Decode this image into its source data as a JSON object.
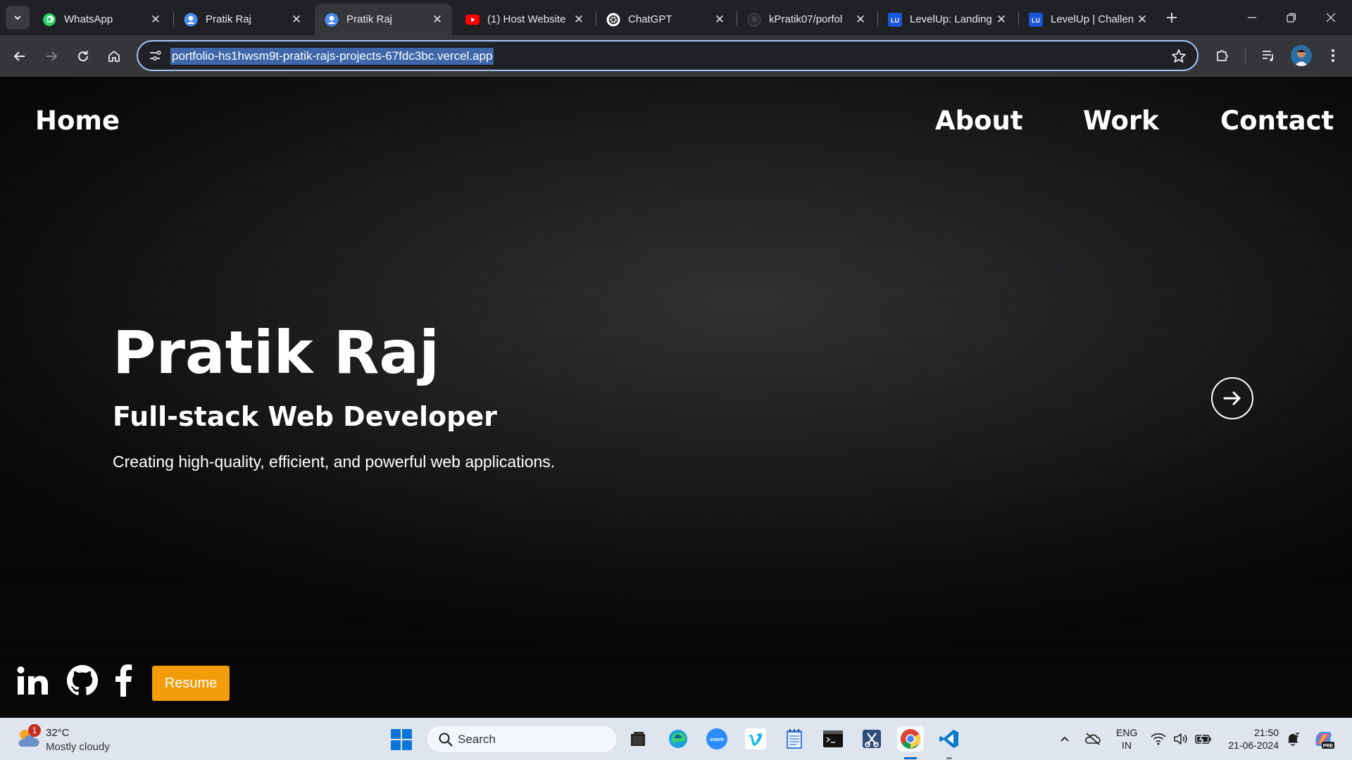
{
  "browser": {
    "tabs": [
      {
        "title": "WhatsApp",
        "favicon": "whatsapp-icon",
        "active": false
      },
      {
        "title": "Pratik Raj",
        "favicon": "profile-icon",
        "active": false
      },
      {
        "title": "Pratik Raj",
        "favicon": "profile-icon",
        "active": true
      },
      {
        "title": "(1) Host Website",
        "favicon": "youtube-icon",
        "active": false
      },
      {
        "title": "ChatGPT",
        "favicon": "chatgpt-icon",
        "active": false
      },
      {
        "title": "kPratik07/porfol",
        "favicon": "github-icon",
        "active": false
      },
      {
        "title": "LevelUp: Landing",
        "favicon": "levelup-icon",
        "active": false
      },
      {
        "title": "LevelUp | Challen",
        "favicon": "levelup-icon",
        "active": false
      }
    ],
    "favicon_text": {
      "levelup": "LU"
    },
    "url": "portfolio-hs1hwsm9t-pratik-rajs-projects-67fdc3bc.vercel.app",
    "accent": "#a8c7fa"
  },
  "page": {
    "nav": {
      "home": "Home",
      "about": "About",
      "work": "Work",
      "contact": "Contact"
    },
    "hero": {
      "name": "Pratik Raj",
      "role": "Full-stack Web Developer",
      "tagline": "Creating high-quality, efficient, and powerful web applications."
    },
    "socials": [
      "linkedin-icon",
      "github-icon",
      "facebook-icon"
    ],
    "resume_label": "Resume",
    "resume_color": "#f39c0b"
  },
  "taskbar": {
    "weather": {
      "temp": "32°C",
      "desc": "Mostly cloudy",
      "badge": "1"
    },
    "search_label": "Search",
    "apps": [
      "file-explorer-icon",
      "edge-icon",
      "zoom-icon",
      "vimeo-icon",
      "notepad-icon",
      "terminal-icon",
      "snipping-tool-icon",
      "chrome-icon",
      "vscode-icon"
    ],
    "zoom_text": "zoom",
    "lang": {
      "line1": "ENG",
      "line2": "IN"
    },
    "copilot_badge": "PRE",
    "clock": {
      "time": "21:50",
      "date": "21-06-2024"
    }
  }
}
